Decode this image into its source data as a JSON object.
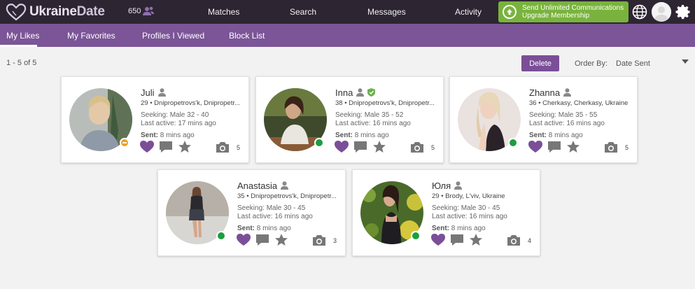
{
  "header": {
    "logo_text_a": "Ukraine",
    "logo_text_b": "Date",
    "count": "650",
    "nav": [
      "Matches",
      "Search",
      "Messages",
      "Activity"
    ],
    "upgrade_line1": "Send Unlimited Communications",
    "upgrade_line2": "Upgrade Membership"
  },
  "subnav": {
    "tabs": [
      "My Likes",
      "My Favorites",
      "Profiles I Viewed",
      "Block List"
    ],
    "active": "My Likes"
  },
  "toolbar": {
    "results": "1 - 5 of 5",
    "delete_label": "Delete",
    "order_label": "Order By:",
    "order_value": "Date Sent"
  },
  "profiles": [
    {
      "name": "Juli",
      "location": "29 • Dnipropetrovs'k, Dnipropetr...",
      "seeking": "Seeking: Male 32 - 40",
      "active": "Last active: 17 mins ago",
      "sent_label": "Sent:",
      "sent": "8 mins ago",
      "photos": "5",
      "status": "away",
      "verified": false
    },
    {
      "name": "Inna",
      "location": "38 • Dnipropetrovs'k, Dnipropetr...",
      "seeking": "Seeking: Male 35 - 52",
      "active": "Last active: 16 mins ago",
      "sent_label": "Sent:",
      "sent": "8 mins ago",
      "photos": "5",
      "status": "online",
      "verified": true
    },
    {
      "name": "Zhanna",
      "location": "36 • Cherkasy, Cherkasy, Ukraine",
      "seeking": "Seeking: Male 35 - 55",
      "active": "Last active: 16 mins ago",
      "sent_label": "Sent:",
      "sent": "8 mins ago",
      "photos": "5",
      "status": "online",
      "verified": false
    },
    {
      "name": "Anastasia",
      "location": "35 • Dnipropetrovs'k, Dnipropetr...",
      "seeking": "Seeking: Male 30 - 45",
      "active": "Last active: 16 mins ago",
      "sent_label": "Sent:",
      "sent": "8 mins ago",
      "photos": "3",
      "status": "online",
      "verified": false
    },
    {
      "name": "Юля",
      "location": "29 • Brody, L'viv, Ukraine",
      "seeking": "Seeking: Male 30 - 45",
      "active": "Last active: 16 mins ago",
      "sent_label": "Sent:",
      "sent": "8 mins ago",
      "photos": "4",
      "status": "online",
      "verified": false
    }
  ],
  "colors": {
    "topbar": "#2e2533",
    "subnav": "#7b5597",
    "accent": "#7b4f98",
    "upgrade": "#79b33d",
    "online": "#1b9e3e",
    "away": "#f0a026"
  },
  "icons": [
    "heart-logo-icon",
    "users-icon",
    "upgrade-arrow-icon",
    "globe-icon",
    "gear-icon",
    "user-icon",
    "verified-shield-icon",
    "heart-icon",
    "message-icon",
    "star-icon",
    "camera-icon"
  ]
}
